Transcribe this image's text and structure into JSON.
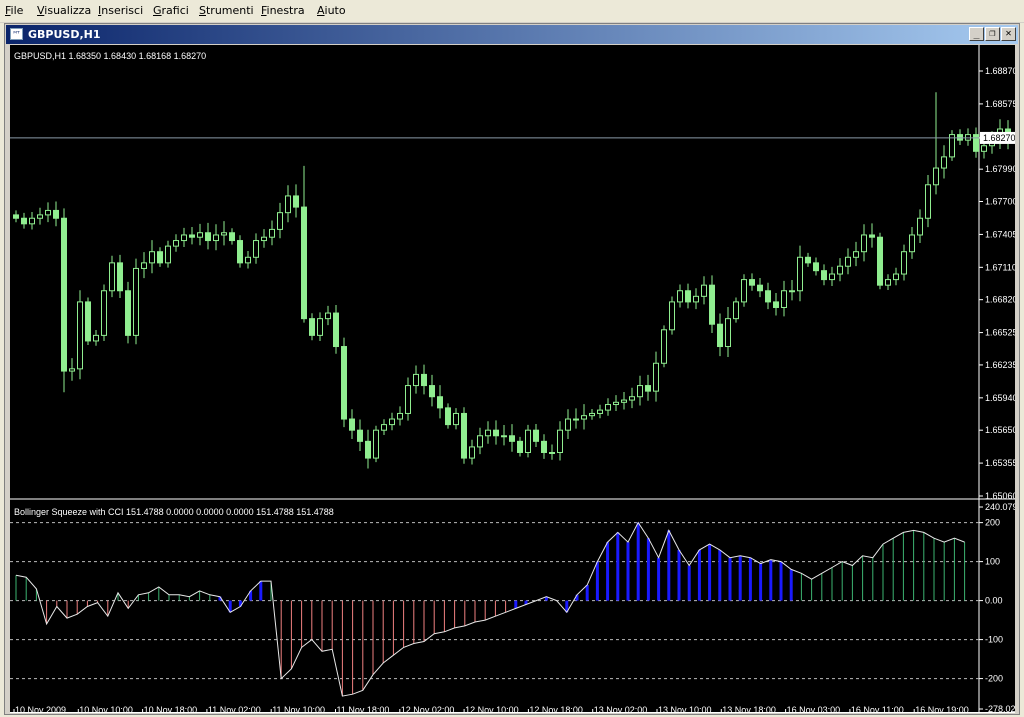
{
  "menu": [
    "File",
    "Visualizza",
    "Inserisci",
    "Grafici",
    "Strumenti",
    "Finestra",
    "Aiuto"
  ],
  "window": {
    "title": "GBPUSD,H1",
    "icon_name": "chart-window-icon",
    "controls": {
      "minimize": "_",
      "restore": "❐",
      "close": "✕"
    }
  },
  "price_chart": {
    "label": "GBPUSD,H1  1.68350 1.68430 1.68168 1.68270",
    "current_price": "1.68270",
    "current_value": 1.6827,
    "ylim": [
      1.6506,
      1.6887
    ],
    "price_ticks": [
      {
        "label": "1.68870",
        "value": 1.6887
      },
      {
        "label": "1.68575",
        "value": 1.68575
      },
      {
        "label": "1.68270",
        "value": 1.6827
      },
      {
        "label": "1.67990",
        "value": 1.6799
      },
      {
        "label": "1.67700",
        "value": 1.677
      },
      {
        "label": "1.67405",
        "value": 1.67405
      },
      {
        "label": "1.67110",
        "value": 1.6711
      },
      {
        "label": "1.66820",
        "value": 1.6682
      },
      {
        "label": "1.66525",
        "value": 1.66525
      },
      {
        "label": "1.66235",
        "value": 1.66235
      },
      {
        "label": "1.65940",
        "value": 1.6594
      },
      {
        "label": "1.65650",
        "value": 1.6565
      },
      {
        "label": "1.65355",
        "value": 1.65355
      },
      {
        "label": "1.65060",
        "value": 1.6506
      }
    ],
    "colors": {
      "background": "#000000",
      "candle": "#90ee90",
      "axis": "#ffffff",
      "price_line": "#8a9aa8"
    }
  },
  "indicator": {
    "label": "Bollinger Squeeze with CCI 151.4788 0.0000 0.0000 0.0000 151.4788 151.4788",
    "ylim": [
      -278.021,
      240.079
    ],
    "ticks": [
      {
        "label": "240.079",
        "value": 240.079
      },
      {
        "label": "200",
        "value": 200
      },
      {
        "label": "100",
        "value": 100
      },
      {
        "label": "0.00",
        "value": 0
      },
      {
        "label": "-100",
        "value": -100
      },
      {
        "label": "-200",
        "value": -200
      },
      {
        "label": "-278.021",
        "value": -278.021
      }
    ],
    "colors": {
      "positive": "#3cb371",
      "negative": "#f08080",
      "squeeze": "#1a1aff",
      "line": "#e8e8e8",
      "level": "#bbbbbb"
    }
  },
  "time_labels": [
    "10 Nov 2009",
    "10 Nov 10:00",
    "10 Nov 18:00",
    "11 Nov 02:00",
    "11 Nov 10:00",
    "11 Nov 18:00",
    "12 Nov 02:00",
    "12 Nov 10:00",
    "12 Nov 18:00",
    "13 Nov 02:00",
    "13 Nov 10:00",
    "13 Nov 18:00",
    "16 Nov 03:00",
    "16 Nov 11:00",
    "16 Nov 19:00"
  ],
  "chart_data": [
    {
      "type": "candlestick",
      "symbol": "GBPUSD",
      "timeframe": "H1",
      "title": "GBPUSD,H1",
      "last_bar": {
        "open": 1.6835,
        "high": 1.6843,
        "low": 1.68168,
        "close": 1.6827
      },
      "ylim": [
        1.6506,
        1.6887
      ],
      "approx_closes": [
        1.6755,
        1.675,
        1.6755,
        1.6758,
        1.6762,
        1.6755,
        1.6618,
        1.662,
        1.668,
        1.6645,
        1.665,
        1.669,
        1.6715,
        1.669,
        1.665,
        1.671,
        1.6715,
        1.6725,
        1.6715,
        1.673,
        1.6735,
        1.674,
        1.6738,
        1.6742,
        1.6735,
        1.674,
        1.6742,
        1.6735,
        1.6715,
        1.672,
        1.6735,
        1.6738,
        1.6745,
        1.676,
        1.6775,
        1.6765,
        1.6665,
        1.665,
        1.6665,
        1.667,
        1.664,
        1.6575,
        1.6565,
        1.6555,
        1.654,
        1.6565,
        1.657,
        1.6575,
        1.658,
        1.6605,
        1.6615,
        1.6605,
        1.6595,
        1.6585,
        1.657,
        1.658,
        1.654,
        1.655,
        1.656,
        1.6565,
        1.656,
        1.656,
        1.6555,
        1.6545,
        1.6565,
        1.6555,
        1.6545,
        1.6545,
        1.6565,
        1.6575,
        1.6575,
        1.6578,
        1.658,
        1.6583,
        1.6588,
        1.659,
        1.6592,
        1.6595,
        1.6605,
        1.66,
        1.6625,
        1.6655,
        1.668,
        1.669,
        1.668,
        1.6685,
        1.6695,
        1.666,
        1.664,
        1.6665,
        1.668,
        1.67,
        1.6695,
        1.669,
        1.668,
        1.6675,
        1.669,
        1.669,
        1.672,
        1.6715,
        1.6708,
        1.67,
        1.6705,
        1.6712,
        1.672,
        1.6725,
        1.674,
        1.6738,
        1.6695,
        1.67,
        1.6705,
        1.6725,
        1.674,
        1.6755,
        1.6785,
        1.68,
        1.681,
        1.683,
        1.6825,
        1.683,
        1.6815,
        1.682,
        1.6825,
        1.6835,
        1.6827
      ]
    },
    {
      "type": "bar",
      "name": "Bollinger Squeeze with CCI",
      "ylim": [
        -278.021,
        240.079
      ],
      "levels": [
        200,
        100,
        0,
        -100,
        -200
      ],
      "values": [
        65,
        60,
        30,
        -60,
        -15,
        -45,
        -35,
        -15,
        -5,
        -40,
        20,
        -20,
        15,
        20,
        35,
        15,
        15,
        10,
        25,
        15,
        10,
        -30,
        -15,
        25,
        50,
        50,
        -200,
        -175,
        -120,
        -100,
        -130,
        -125,
        -245,
        -240,
        -230,
        -190,
        -160,
        -140,
        -120,
        -110,
        -105,
        -85,
        -80,
        -70,
        -65,
        -55,
        -50,
        -40,
        -30,
        -20,
        -10,
        0,
        10,
        0,
        -30,
        15,
        40,
        100,
        150,
        175,
        150,
        200,
        160,
        110,
        180,
        130,
        90,
        130,
        145,
        130,
        110,
        115,
        110,
        95,
        105,
        100,
        80,
        70,
        55,
        70,
        85,
        100,
        90,
        115,
        110,
        145,
        160,
        175,
        180,
        175,
        160,
        150,
        160,
        150
      ]
    }
  ]
}
